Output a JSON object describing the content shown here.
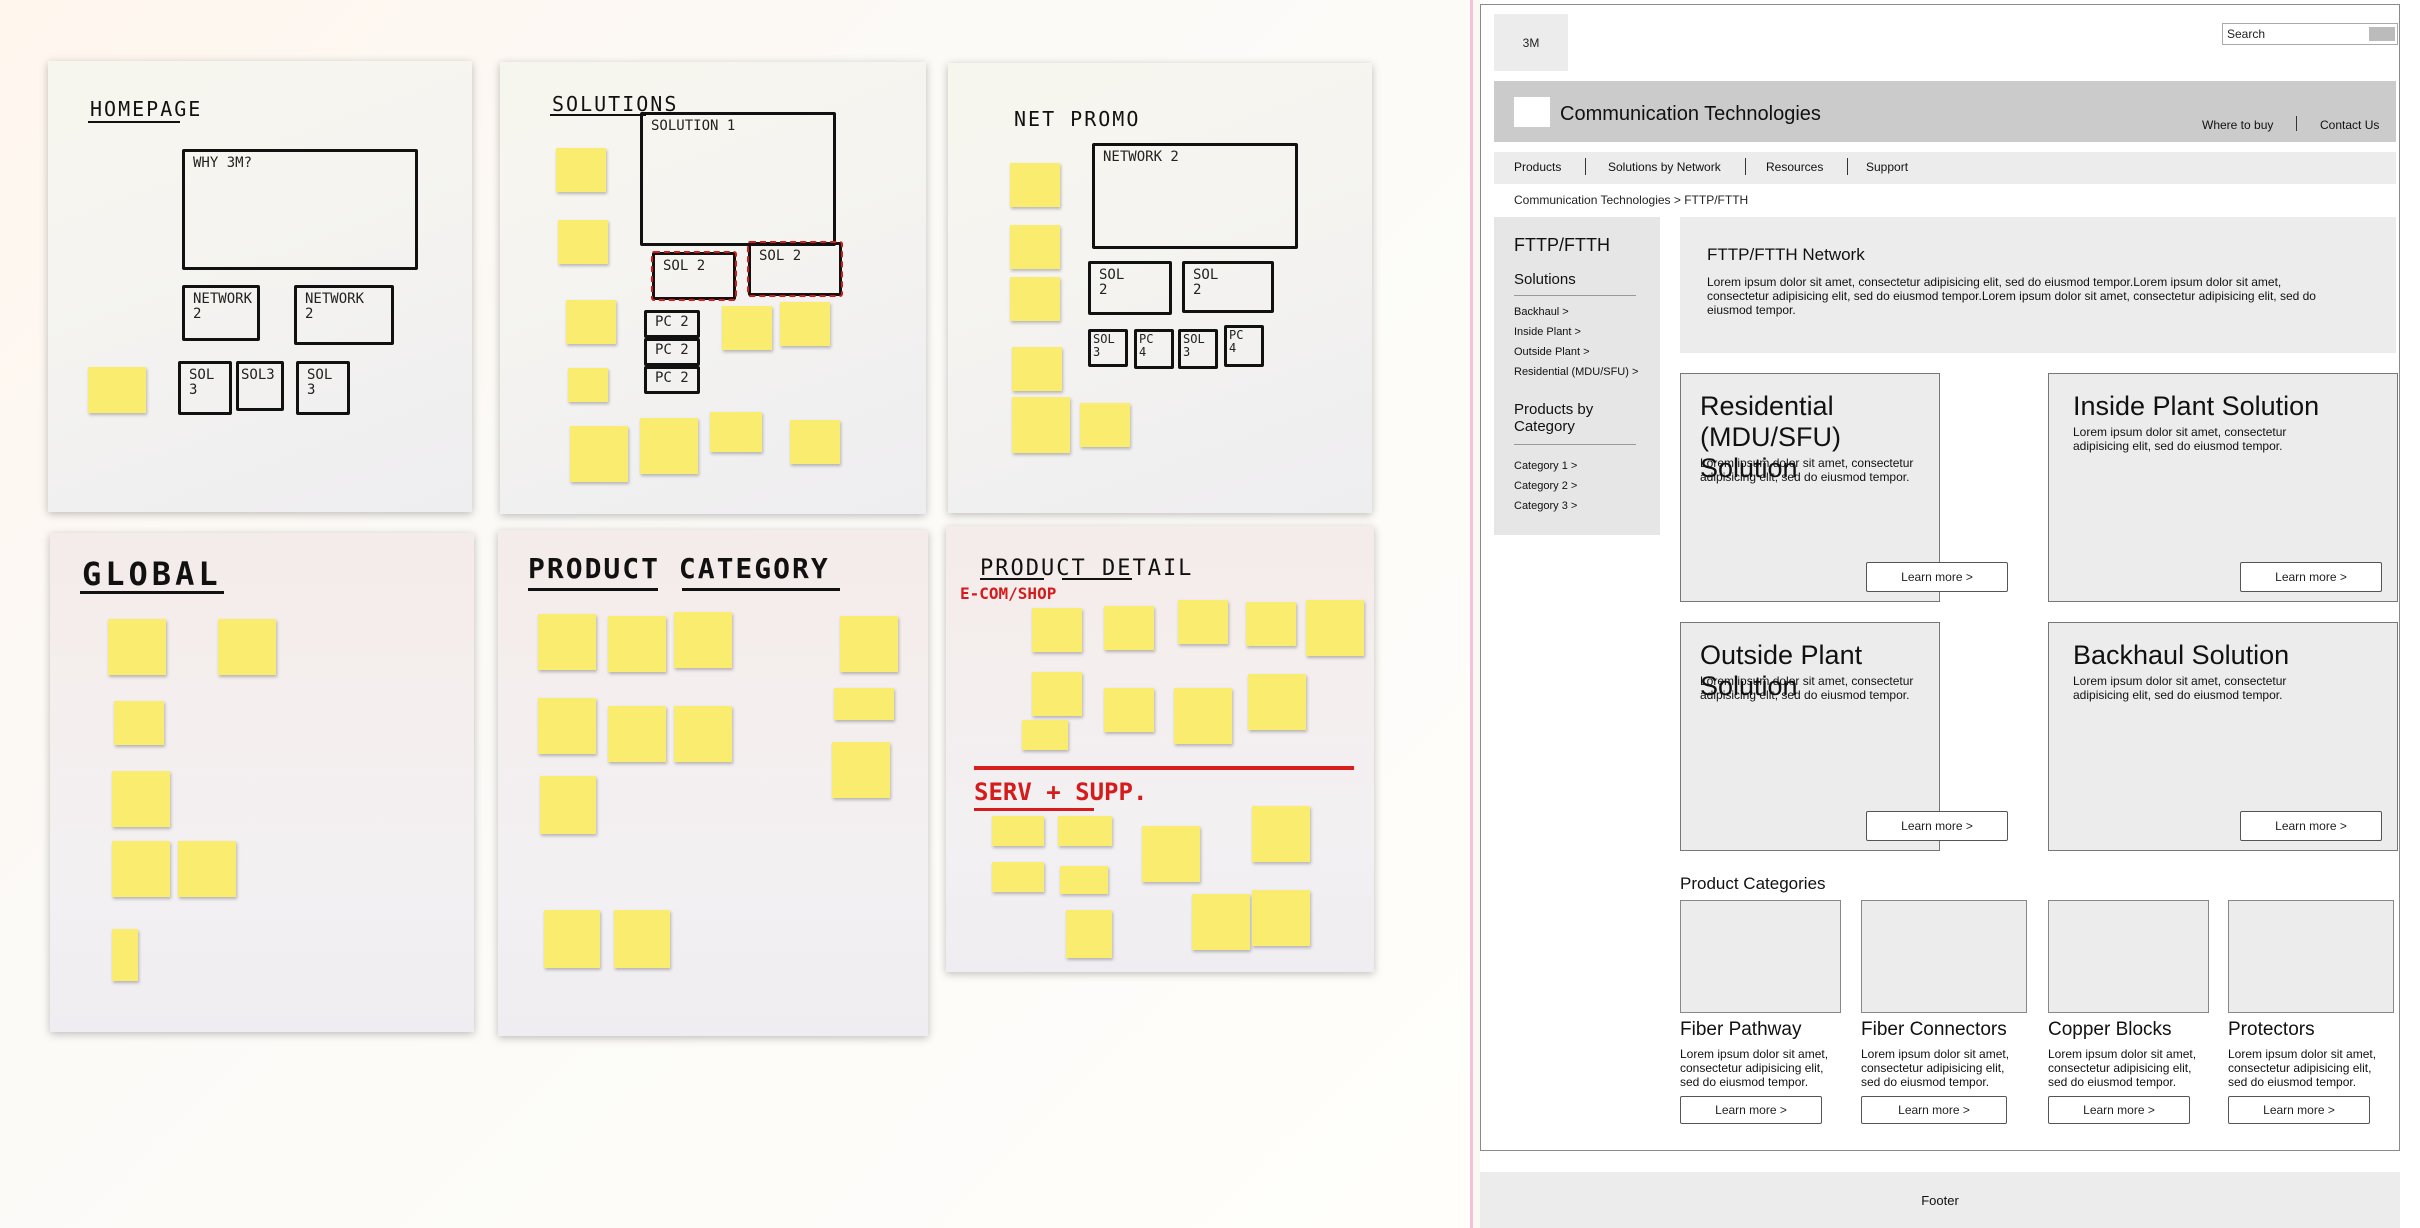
{
  "sketches": {
    "homepage": {
      "title": "HOMEPAGE",
      "hero": "WHY 3M?",
      "network_left": "NETWORK\n2",
      "network_right": "NETWORK\n2",
      "sol_a": "SOL\n3",
      "sol_b": "SOL3",
      "sol_c": "SOL\n3"
    },
    "solutions": {
      "title": "SOLUTIONS",
      "hero": "SOLUTION 1",
      "sol_left": "SOL 2",
      "sol_right": "SOL 2",
      "pc_1": "PC 2",
      "pc_2": "PC 2",
      "pc_3": "PC 2"
    },
    "net_promo": {
      "title": "NET PROMO",
      "hero": "NETWORK 2",
      "sol_left": "SOL\n2",
      "sol_right": "SOL\n2",
      "sub_1": "SOL\n3",
      "sub_2": "PC\n4",
      "sub_3": "SOL\n3",
      "sub_4": "PC\n4"
    },
    "global": {
      "title": "GLOBAL"
    },
    "product_category": {
      "title": "PRODUCT   CATEGORY"
    },
    "product_detail": {
      "title": "PRODUCT  DETAIL",
      "section_1": "E-COM/SHOP",
      "section_2": "SERV + SUPP."
    }
  },
  "wireframe": {
    "logo": "3M",
    "search_label": "Search",
    "site_title": "Communication Technologies",
    "util_links": [
      "Where to buy",
      "Contact Us"
    ],
    "nav": [
      "Products",
      "Solutions by Network",
      "Resources",
      "Support"
    ],
    "breadcrumb": "Communication Technologies > FTTP/FTTH",
    "leftnav": {
      "heading": "FTTP/FTTH",
      "solutions_label": "Solutions",
      "solutions": [
        "Backhaul >",
        "Inside Plant >",
        "Outside Plant >",
        "Residential (MDU/SFU) >"
      ],
      "category_label_1": "Products by",
      "category_label_2": "Category",
      "categories": [
        "Category 1 >",
        "Category 2 >",
        "Category 3 >"
      ]
    },
    "intro": {
      "title": "FTTP/FTTH Network",
      "body": "Lorem ipsum dolor sit amet, consectetur adipisicing elit, sed do eiusmod tempor.Lorem ipsum dolor sit amet, consectetur adipisicing elit, sed do eiusmod tempor.Lorem ipsum dolor sit amet, consectetur adipisicing elit, sed do eiusmod tempor."
    },
    "solution_cards": [
      {
        "title": "Residential (MDU/SFU) Solution",
        "body": "Lorem ipsum dolor sit amet, consectetur adipisicing elit, sed do eiusmod tempor.",
        "button": "Learn more >"
      },
      {
        "title": "Inside Plant Solution",
        "body": "Lorem ipsum dolor sit amet, consectetur adipisicing elit, sed do eiusmod tempor.",
        "button": "Learn more >"
      },
      {
        "title": "Outside Plant Solution",
        "body": "Lorem ipsum dolor sit amet, consectetur adipisicing elit, sed do eiusmod tempor.",
        "button": "Learn more >"
      },
      {
        "title": "Backhaul Solution",
        "body": "Lorem ipsum dolor sit amet, consectetur adipisicing elit, sed do eiusmod tempor.",
        "button": "Learn more >"
      }
    ],
    "product_categories_heading": "Product Categories",
    "product_categories": [
      {
        "title": "Fiber Pathway",
        "body": "Lorem ipsum dolor sit amet, consectetur adipisicing elit, sed do eiusmod tempor.",
        "button": "Learn more >"
      },
      {
        "title": "Fiber Connectors",
        "body": "Lorem ipsum dolor sit amet, consectetur adipisicing elit, sed do eiusmod tempor.",
        "button": "Learn more >"
      },
      {
        "title": "Copper Blocks",
        "body": "Lorem ipsum dolor sit amet, consectetur adipisicing elit, sed do eiusmod tempor.",
        "button": "Learn more >"
      },
      {
        "title": "Protectors",
        "body": "Lorem ipsum dolor sit amet, consectetur adipisicing elit, sed do eiusmod tempor.",
        "button": "Learn more >"
      }
    ],
    "footer": "Footer"
  }
}
